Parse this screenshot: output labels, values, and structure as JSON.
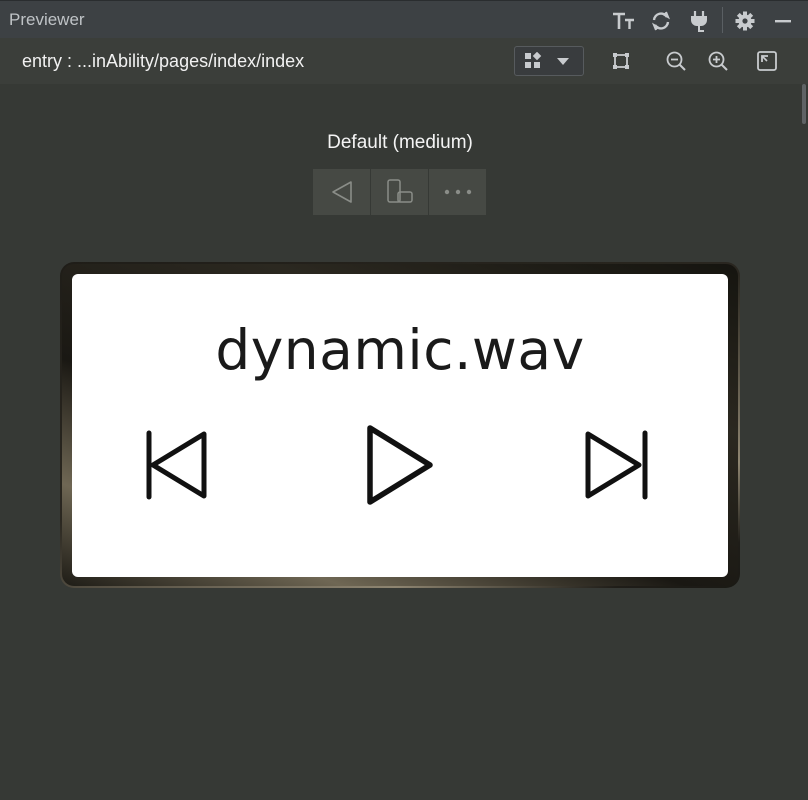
{
  "window": {
    "title": "Previewer"
  },
  "toolbar": {
    "icons": [
      "font-size-icon",
      "refresh-icon",
      "plug-icon",
      "gear-icon",
      "minimize-icon"
    ]
  },
  "pathbar": {
    "path": "entry : ...inAbility/pages/index/index",
    "icons": [
      "device-layout-icon",
      "chevron-down-icon",
      "crop-icon",
      "zoom-out-icon",
      "zoom-in-icon",
      "fit-screen-icon"
    ]
  },
  "preview": {
    "mode_label": "Default (medium)",
    "device_toolbar": [
      "back-icon",
      "rotate-icon",
      "more-icon"
    ]
  },
  "app": {
    "song_title": "dynamic.wav",
    "controls": [
      "previous-icon",
      "play-icon",
      "next-icon"
    ]
  },
  "colors": {
    "background": "#363935",
    "titlebar": "#3d4144",
    "screen": "#ffffff",
    "icon": "#c8cbce"
  }
}
